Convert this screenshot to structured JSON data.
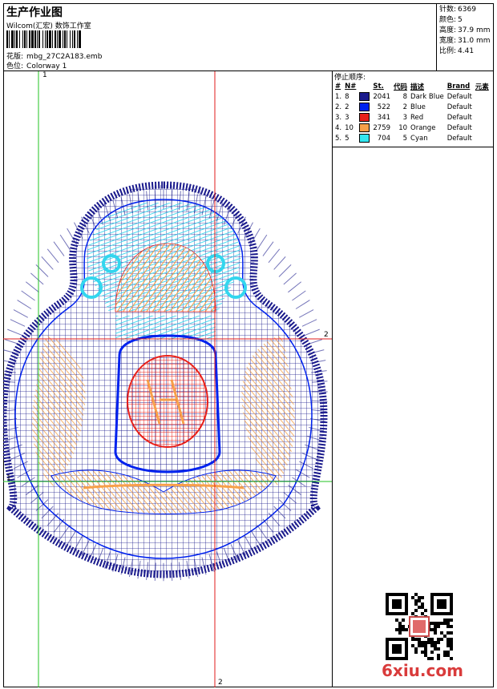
{
  "header": {
    "title": "生产作业图",
    "company": "Wilcom(汇宏) 数饰工作室",
    "design_label": "花版:",
    "design_value": "mbg_27C2A183.emb",
    "colorway_label": "色位:",
    "colorway_value": "Colorway 1"
  },
  "stats": [
    {
      "label": "针数:",
      "value": "6369"
    },
    {
      "label": "颜色:",
      "value": "5"
    },
    {
      "label": "高度:",
      "value": "37.9 mm"
    },
    {
      "label": "宽度:",
      "value": "31.0 mm"
    },
    {
      "label": "比例:",
      "value": "4.41"
    }
  ],
  "stop_sequence": {
    "title": "停止顺序:",
    "headers": [
      "#",
      "N#",
      "St.",
      "代码",
      "描述",
      "Brand",
      "元素"
    ],
    "rows": [
      {
        "idx": "1.",
        "n": "8",
        "color": "#1a1a8c",
        "st": "2041",
        "code": "8",
        "desc": "Dark Blue",
        "brand": "Default",
        "element": ""
      },
      {
        "idx": "2.",
        "n": "2",
        "color": "#0022ee",
        "st": "522",
        "code": "2",
        "desc": "Blue",
        "brand": "Default",
        "element": ""
      },
      {
        "idx": "3.",
        "n": "3",
        "color": "#e8201a",
        "st": "341",
        "code": "3",
        "desc": "Red",
        "brand": "Default",
        "element": ""
      },
      {
        "idx": "4.",
        "n": "10",
        "color": "#f7a04a",
        "st": "2759",
        "code": "10",
        "desc": "Orange",
        "brand": "Default",
        "element": ""
      },
      {
        "idx": "5.",
        "n": "5",
        "color": "#33e6f0",
        "st": "704",
        "code": "5",
        "desc": "Cyan",
        "brand": "Default",
        "element": ""
      }
    ]
  },
  "guides": {
    "vertical_1": "1",
    "vertical_2": "2",
    "horizontal_1": "1",
    "horizontal_2": "2"
  },
  "watermark": "6xiu.com",
  "colors": {
    "guide_green": "#22c322",
    "guide_red": "#e21b1b",
    "dark_blue": "#1a1a8c",
    "blue": "#0022ee",
    "red": "#e8201a",
    "orange": "#f7a04a",
    "cyan": "#33e6f0"
  }
}
